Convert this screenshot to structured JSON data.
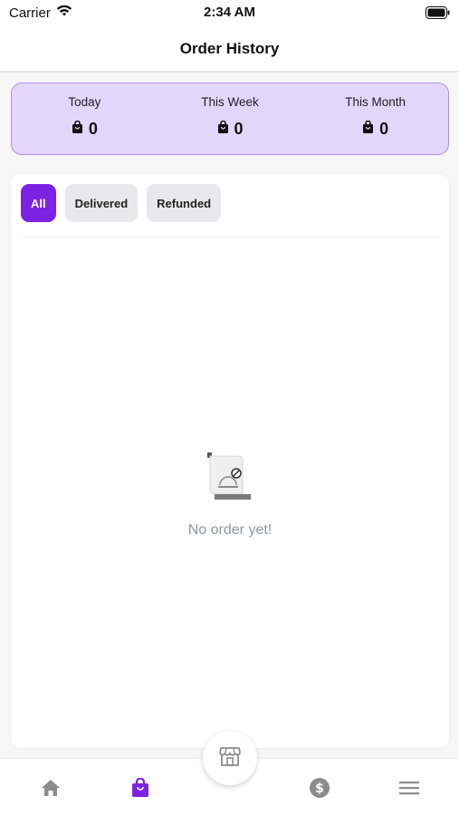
{
  "status_bar": {
    "carrier": "Carrier",
    "time": "2:34 AM",
    "icons": [
      "wifi-icon",
      "battery-icon"
    ]
  },
  "header": {
    "title": "Order History"
  },
  "summary": [
    {
      "label": "Today",
      "value": "0",
      "icon": "bag-icon"
    },
    {
      "label": "This Week",
      "value": "0",
      "icon": "bag-icon"
    },
    {
      "label": "This Month",
      "value": "0",
      "icon": "bag-icon"
    }
  ],
  "tabs": [
    {
      "label": "All",
      "active": true
    },
    {
      "label": "Delivered",
      "active": false
    },
    {
      "label": "Refunded",
      "active": false
    }
  ],
  "empty_state": {
    "icon": "empty-order-icon",
    "text": "No order yet!"
  },
  "bottom_nav": {
    "items": [
      "home-icon",
      "orders-bag-icon",
      "store-icon",
      "dollar-icon",
      "menu-icon"
    ],
    "active": "orders-bag-icon"
  },
  "colors": {
    "accent": "#7c22e2",
    "summary_bg": "#e2d6fb",
    "summary_border": "#b48ff0",
    "inactive_icon": "#8c8c8c",
    "empty_text": "#8d97ad"
  }
}
